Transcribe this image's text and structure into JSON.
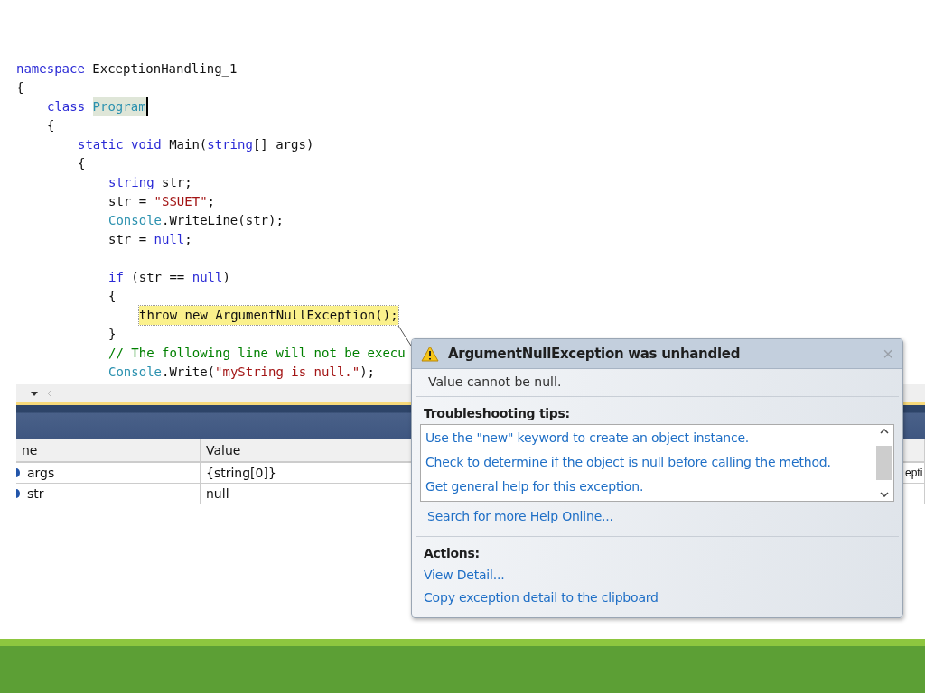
{
  "editor": {
    "lines": [
      {
        "tokens": [
          {
            "text": "namespace",
            "kind": "keyword"
          },
          {
            "text": " ExceptionHandling_1",
            "kind": "plain"
          }
        ]
      },
      {
        "tokens": [
          {
            "text": "{",
            "kind": "plain"
          }
        ],
        "children": [
          {
            "tokens": [
              {
                "text": "class ",
                "kind": "keyword"
              },
              {
                "text": "Program",
                "kind": "type",
                "highlighted": true
              }
            ]
          },
          {
            "tokens": [
              {
                "text": "{",
                "kind": "plain"
              }
            ],
            "children": [
              {
                "tokens": [
                  {
                    "text": "static void",
                    "kind": "keyword"
                  },
                  {
                    "text": " Main(",
                    "kind": "plain"
                  },
                  {
                    "text": "string",
                    "kind": "keyword"
                  },
                  {
                    "text": "[] args)",
                    "kind": "plain"
                  }
                ]
              },
              {
                "tokens": [
                  {
                    "text": "{",
                    "kind": "plain"
                  }
                ],
                "children": [
                  {
                    "tokens": [
                      {
                        "text": "string",
                        "kind": "keyword"
                      },
                      {
                        "text": " str;",
                        "kind": "plain"
                      }
                    ]
                  },
                  {
                    "tokens": [
                      {
                        "text": "str = ",
                        "kind": "plain"
                      },
                      {
                        "text": "\"SSUET\"",
                        "kind": "string"
                      },
                      {
                        "text": ";",
                        "kind": "plain"
                      }
                    ]
                  },
                  {
                    "tokens": [
                      {
                        "text": "Console",
                        "kind": "type"
                      },
                      {
                        "text": ".WriteLine(str);",
                        "kind": "plain"
                      }
                    ]
                  },
                  {
                    "tokens": [
                      {
                        "text": "str = ",
                        "kind": "plain"
                      },
                      {
                        "text": "null",
                        "kind": "keyword"
                      },
                      {
                        "text": ";",
                        "kind": "plain"
                      }
                    ]
                  },
                  {
                    "kind": "blank"
                  },
                  {
                    "tokens": [
                      {
                        "text": "if",
                        "kind": "keyword"
                      },
                      {
                        "text": " (str == ",
                        "kind": "plain"
                      },
                      {
                        "text": "null",
                        "kind": "keyword"
                      },
                      {
                        "text": ")",
                        "kind": "plain"
                      }
                    ]
                  },
                  {
                    "tokens": [
                      {
                        "text": "{",
                        "kind": "plain"
                      }
                    ],
                    "children": [
                      {
                        "tokens": [
                          {
                            "text": "throw new ArgumentNullException();",
                            "kind": "plain",
                            "current_statement": true
                          }
                        ]
                      }
                    ]
                  },
                  {
                    "tokens": [
                      {
                        "text": "}",
                        "kind": "plain"
                      }
                    ]
                  },
                  {
                    "tokens": [
                      {
                        "text": "// The following line will not be execu",
                        "kind": "comment"
                      }
                    ]
                  },
                  {
                    "tokens": [
                      {
                        "text": "Console",
                        "kind": "type"
                      },
                      {
                        "text": ".Write(",
                        "kind": "plain"
                      },
                      {
                        "text": "\"myString is null.\"",
                        "kind": "string"
                      },
                      {
                        "text": ");",
                        "kind": "plain"
                      }
                    ]
                  }
                ]
              }
            ]
          }
        ]
      }
    ]
  },
  "locals": {
    "columns": [
      "ne",
      "Value"
    ],
    "rows": [
      {
        "name": "args",
        "value": "{string[0]}",
        "column_3": "epti"
      },
      {
        "name": "str",
        "value": "null"
      }
    ]
  },
  "exception_popup": {
    "title": "ArgumentNullException was unhandled",
    "close": "×",
    "message": "Value cannot be null.",
    "tips_heading": "Troubleshooting tips:",
    "tips": [
      "Use the \"new\" keyword to create an object instance.",
      "Check to determine if the object is null before calling the method.",
      "Get general help for this exception."
    ],
    "search_link": "Search for more Help Online...",
    "actions_heading": "Actions:",
    "actions": [
      "View Detail...",
      "Copy exception detail to the clipboard"
    ]
  }
}
